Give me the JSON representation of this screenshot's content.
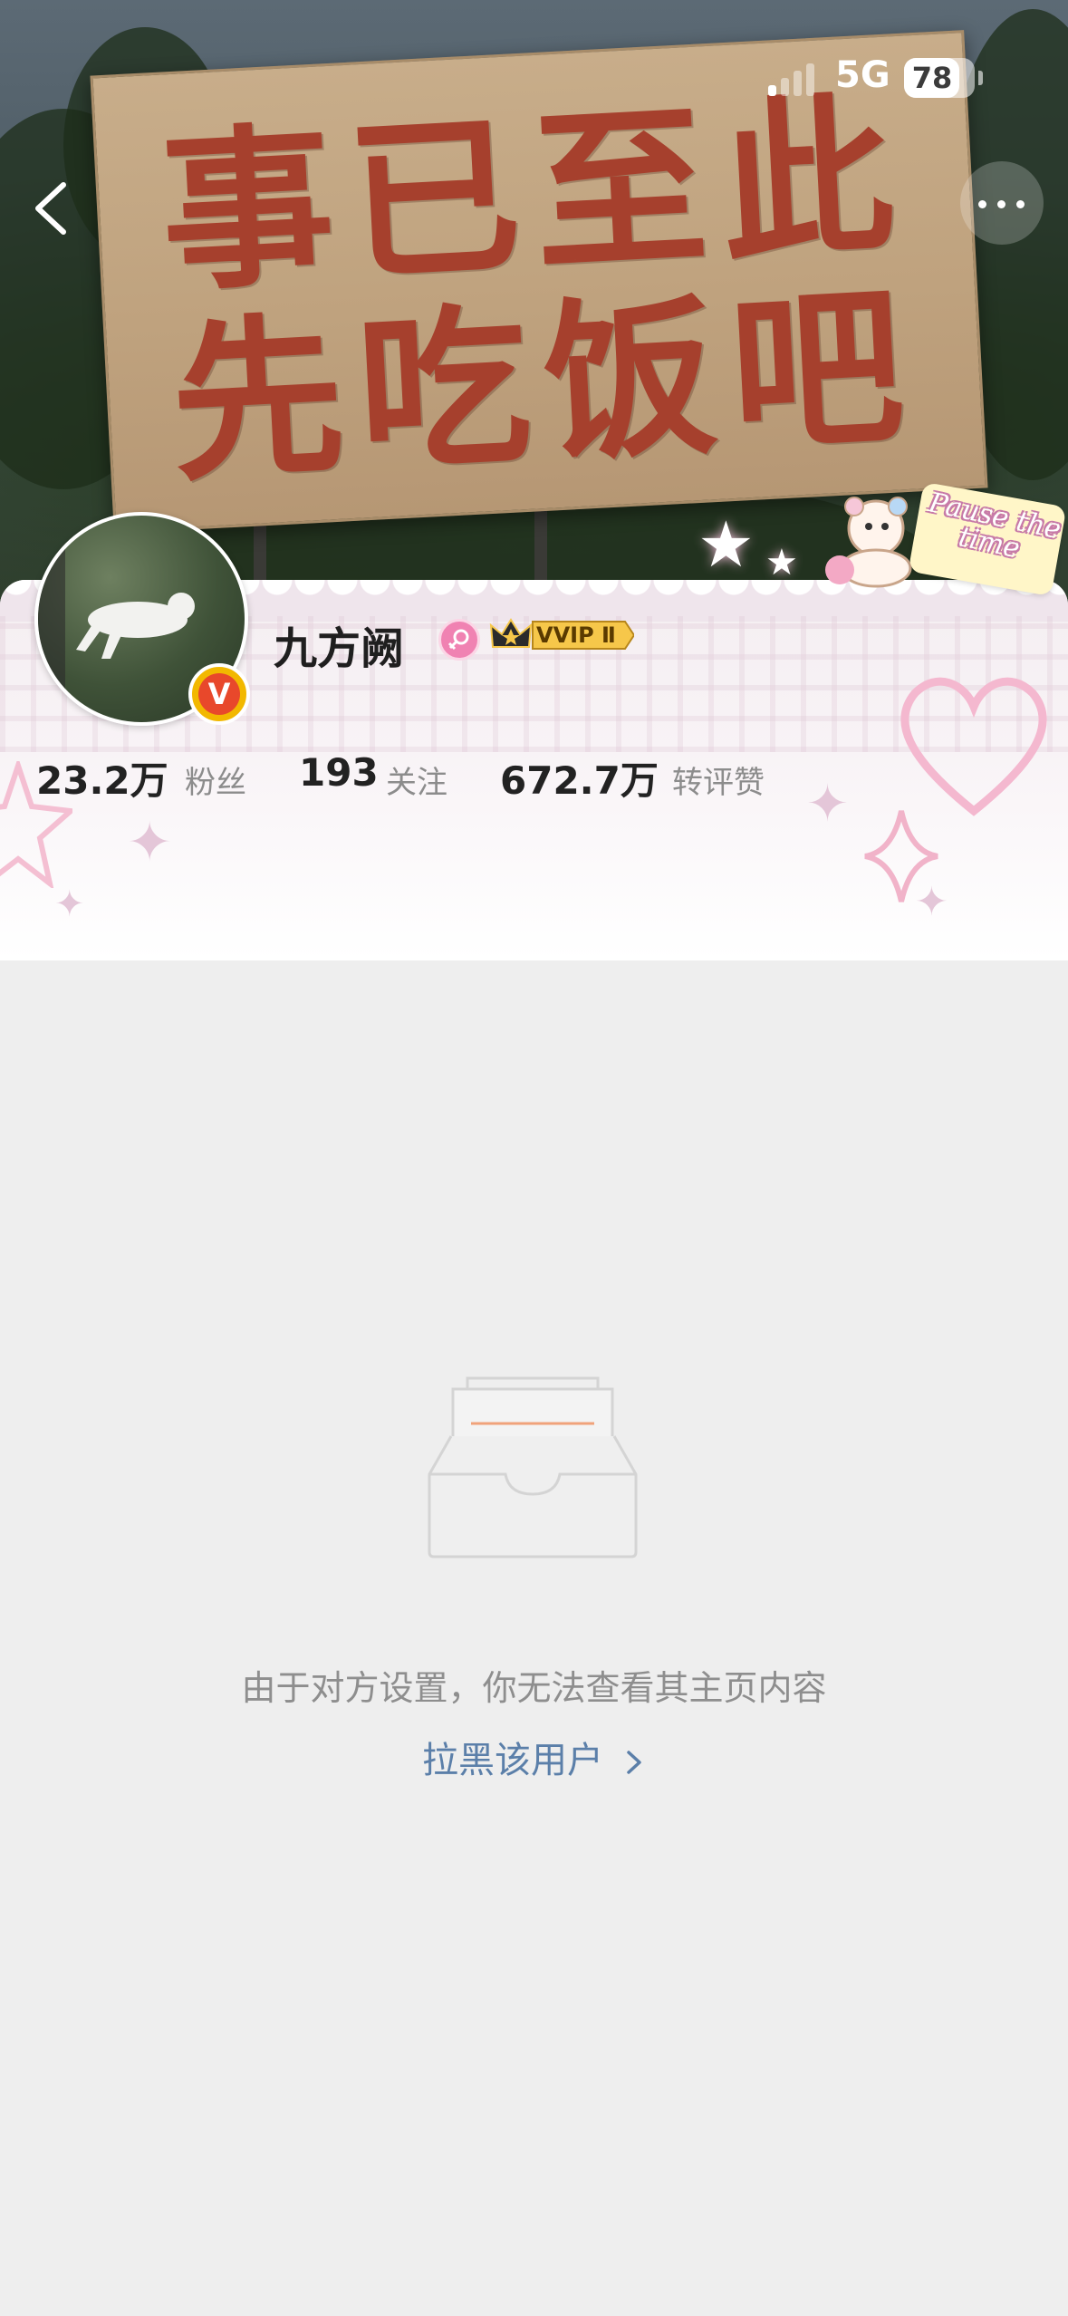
{
  "status_bar": {
    "network": "5G",
    "battery": "78",
    "battery_level": 0.78
  },
  "banner": {
    "sign_line_1": "事已至此",
    "sign_line_2": "先吃饭吧",
    "sticker_text": "Pause the time"
  },
  "profile": {
    "name": "九方阙",
    "vip_badge": "VVIP Ⅱ",
    "stats": {
      "fans_count": "23.2万",
      "fans_label": "粉丝",
      "following_count": "193",
      "following_label": "关注",
      "interactions_count": "672.7万",
      "interactions_label": "转评赞"
    }
  },
  "content": {
    "restricted_message": "由于对方设置，你无法查看其主页内容",
    "block_link": "拉黑该用户"
  },
  "colors": {
    "link": "#5b7fa9",
    "sign_text": "#a6402d",
    "verified": "#e8482b",
    "empty_accent": "#f0a27a"
  },
  "icons": {
    "back": "chevron-left-icon",
    "more": "ellipsis-icon",
    "gender": "female-icon",
    "verified": "verified-v-icon",
    "empty": "empty-box-icon"
  }
}
